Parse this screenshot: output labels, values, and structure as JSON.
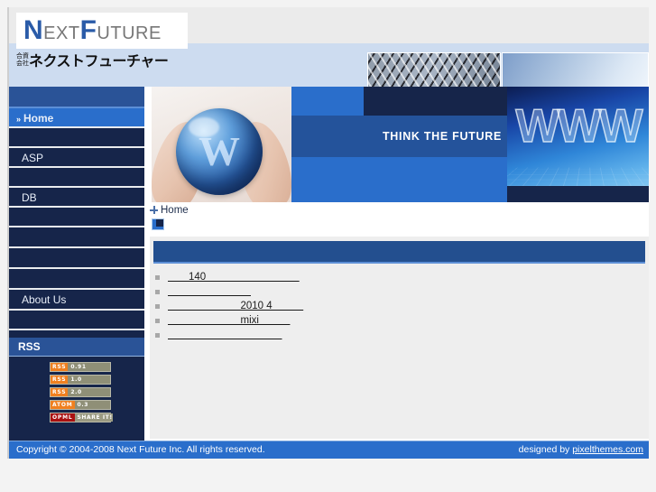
{
  "site": {
    "logo_cap_n": "N",
    "logo_word1_rest": "EXT",
    "logo_cap_f": "F",
    "logo_word2_rest": "UTURE",
    "logo_ja_small_line1": "合資",
    "logo_ja_small_line2": "会社",
    "logo_ja_main": "ネクストフューチャー"
  },
  "banner": {
    "slogan": "THINK THE FUTURE",
    "www_text": "WWW",
    "globe_letter": "W"
  },
  "sidebar": {
    "nav": [
      {
        "label": "Home",
        "active": true,
        "chevron": "»"
      },
      {
        "label": "",
        "active": false
      },
      {
        "label": "ASP",
        "active": false
      },
      {
        "label": "",
        "active": false
      },
      {
        "label": "DB",
        "active": false
      },
      {
        "label": "",
        "active": false
      },
      {
        "label": "",
        "active": false
      },
      {
        "label": "",
        "active": false
      },
      {
        "label": "",
        "active": false
      },
      {
        "label": "About Us",
        "active": false
      },
      {
        "label": "",
        "active": false
      }
    ],
    "rss_header": "RSS",
    "rss_badges": [
      {
        "tag": "RSS",
        "value": "0.91",
        "dark": false
      },
      {
        "tag": "RSS",
        "value": "1.0",
        "dark": false
      },
      {
        "tag": "RSS",
        "value": "2.0",
        "dark": false
      },
      {
        "tag": "ATOM",
        "value": "0.3",
        "dark": false
      },
      {
        "tag": "OPML",
        "value": "SHARE IT!",
        "dark": true
      }
    ]
  },
  "breadcrumb": {
    "label": "Home"
  },
  "main": {
    "panel_items": [
      {
        "text": "　　140　　　　　　　　　"
      },
      {
        "text": "　　　　　　　　"
      },
      {
        "text": "　　　　　　　2010 4　　　"
      },
      {
        "text": "　　　　　　　mixi　　　"
      },
      {
        "text": "　　　　　　　　　　　"
      }
    ]
  },
  "footer": {
    "copyright": "Copyright © 2004-2008 Next Future Inc. All rights reserved.",
    "designed_by_prefix": "designed by ",
    "designed_by_link": "pixelthemes.com"
  },
  "colors": {
    "nav_dark": "#16254a",
    "nav_active": "#2a6ecb",
    "accent_blue": "#2a5397",
    "panel_head": "#234f8f",
    "footer_bg": "#2a6ecb",
    "page_bg": "#f3f3f3",
    "content_bg": "#eeeeee"
  }
}
